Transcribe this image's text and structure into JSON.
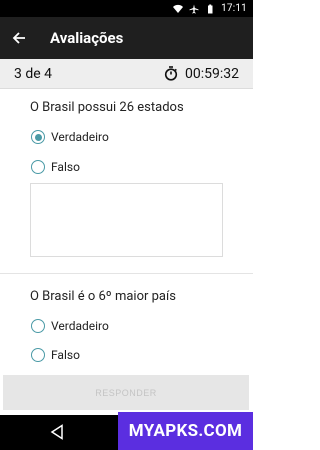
{
  "status_bar": {
    "time": "17:11",
    "icons": [
      "wifi-icon",
      "airplane-icon",
      "battery-icon"
    ]
  },
  "app_bar": {
    "title": "Avaliações",
    "back_icon": "arrow-back-icon"
  },
  "progress": {
    "counter": "3 de 4",
    "timer": "00:59:32",
    "timer_icon": "stopwatch-icon"
  },
  "questions": [
    {
      "text": "O Brasil possui 26 estados",
      "options": [
        {
          "label": "Verdadeiro",
          "selected": true
        },
        {
          "label": "Falso",
          "selected": false
        }
      ]
    },
    {
      "text": "O Brasil é o 6º maior país",
      "options": [
        {
          "label": "Verdadeiro",
          "selected": false
        },
        {
          "label": "Falso",
          "selected": false
        }
      ]
    }
  ],
  "respond_button": {
    "label": "RESPONDER"
  },
  "watermark": {
    "text": "MYAPKS.COM"
  },
  "colors": {
    "accent": "#4a9aa6",
    "app_bar": "#1f1f1f",
    "watermark_bg": "#5b2ee0"
  }
}
